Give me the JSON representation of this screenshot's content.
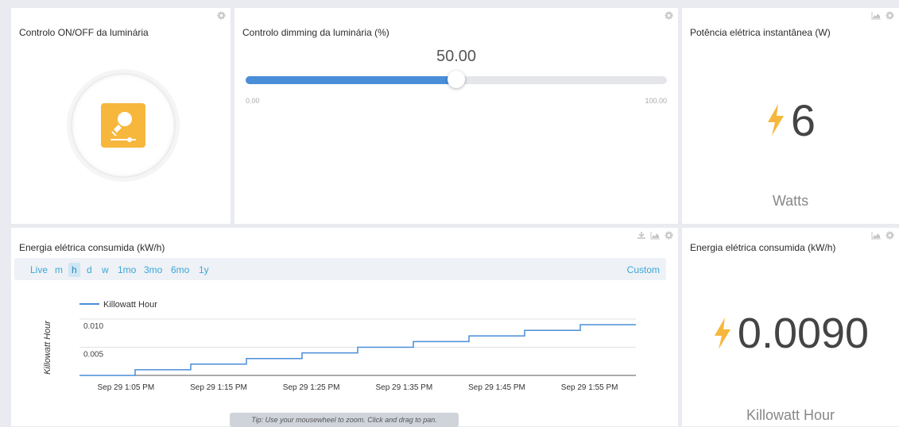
{
  "panels": {
    "toggle": {
      "title": "Controlo ON/OFF da luminária"
    },
    "dimmer": {
      "title": "Controlo dimming da luminária (%)",
      "value": "50.00",
      "min": "0.00",
      "max": "100.00",
      "level_fraction": 0.5
    },
    "power": {
      "title": "Potência elétrica instantânea (W)",
      "value": "6",
      "unit": "Watts"
    },
    "energy_chart": {
      "title": "Energia elétrica consumida (kW/h)",
      "ranges": [
        "Live",
        "m",
        "h",
        "d",
        "w",
        "1mo",
        "3mo",
        "6mo",
        "1y"
      ],
      "active_range": "h",
      "custom_label": "Custom",
      "tip": "Tip: Use your mousewheel to zoom. Click and drag to pan."
    },
    "energy_value": {
      "title": "Energia elétrica consumida (kW/h)",
      "value": "0.0090",
      "unit": "Killowatt Hour"
    }
  },
  "chart_data": {
    "type": "line",
    "title": "",
    "ylabel": "Killowatt Hour",
    "xlabel": "",
    "series": [
      {
        "name": "Killowatt Hour",
        "color": "#4a8ed8",
        "points": [
          [
            "13:00",
            0.0
          ],
          [
            "13:06",
            0.0
          ],
          [
            "13:06",
            0.001
          ],
          [
            "13:12",
            0.001
          ],
          [
            "13:12",
            0.002
          ],
          [
            "13:18",
            0.002
          ],
          [
            "13:18",
            0.003
          ],
          [
            "13:24",
            0.003
          ],
          [
            "13:24",
            0.004
          ],
          [
            "13:30",
            0.004
          ],
          [
            "13:30",
            0.005
          ],
          [
            "13:36",
            0.005
          ],
          [
            "13:36",
            0.006
          ],
          [
            "13:42",
            0.006
          ],
          [
            "13:42",
            0.007
          ],
          [
            "13:48",
            0.007
          ],
          [
            "13:48",
            0.008
          ],
          [
            "13:54",
            0.008
          ],
          [
            "13:54",
            0.009
          ],
          [
            "14:00",
            0.009
          ]
        ]
      }
    ],
    "x_ticks": [
      "Sep 29 1:05 PM",
      "Sep 29 1:15 PM",
      "Sep 29 1:25 PM",
      "Sep 29 1:35 PM",
      "Sep 29 1:45 PM",
      "Sep 29 1:55 PM"
    ],
    "x_tick_minutes": [
      5,
      15,
      25,
      35,
      45,
      55
    ],
    "y_ticks": [
      "0.010",
      "0.005"
    ],
    "y_tick_values": [
      0.01,
      0.005
    ],
    "ylim": [
      0,
      0.01
    ],
    "xlim_minutes": [
      0,
      60
    ],
    "grid": true,
    "legend": "top-left"
  },
  "icons": [
    "gear-icon",
    "area-chart-icon",
    "download-icon",
    "bulb-icon",
    "lightning-icon"
  ],
  "colors": {
    "accent": "#4a8ed8",
    "tile": "#f6b73c",
    "bolt": "#f6b73c",
    "link": "#3ba7d9"
  }
}
